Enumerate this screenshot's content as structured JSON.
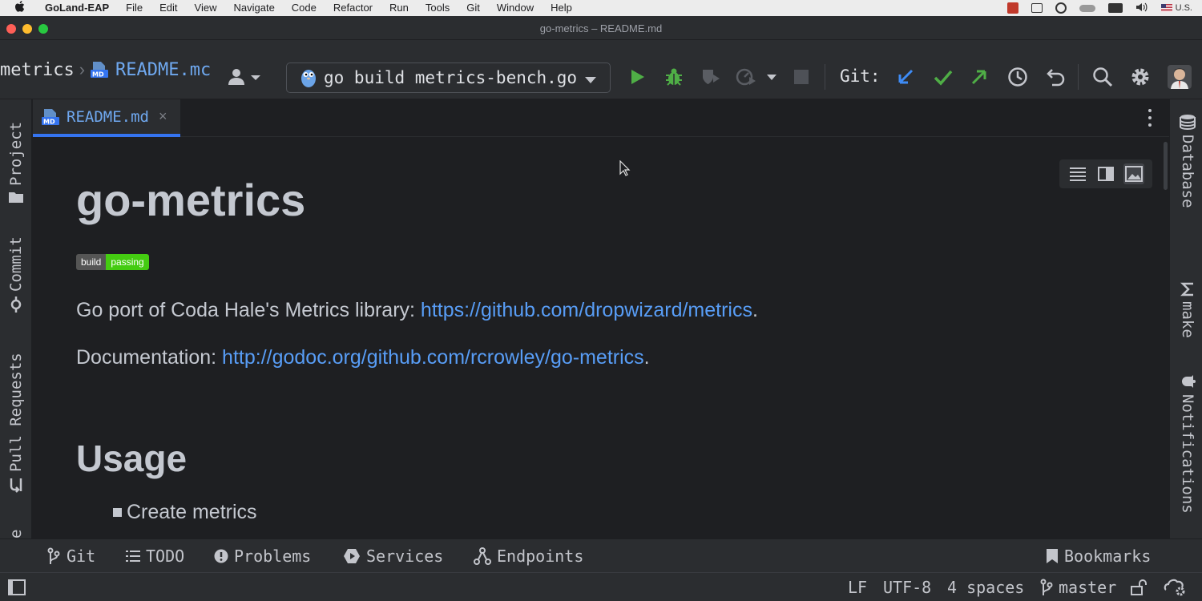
{
  "menubar": {
    "app": "GoLand-EAP",
    "items": [
      "File",
      "Edit",
      "View",
      "Navigate",
      "Code",
      "Refactor",
      "Run",
      "Tools",
      "Git",
      "Window",
      "Help"
    ],
    "input_source": "U.S."
  },
  "window": {
    "title": "go-metrics – README.md"
  },
  "toolbar": {
    "project_crumb": "metrics",
    "file_crumb": "README.mc",
    "run_config": "go build metrics-bench.go",
    "git_label": "Git:"
  },
  "left_stripe": {
    "project": "Project",
    "commit": "Commit",
    "pull_requests": "Pull Requests",
    "cut_label": "e"
  },
  "right_stripe": {
    "database": "Database",
    "make": "make",
    "notifications": "Notifications"
  },
  "tabs": [
    {
      "label": "README.md",
      "active": true
    }
  ],
  "preview": {
    "title": "go-metrics",
    "badge_left": "build",
    "badge_right": "passing",
    "line1_text": "Go port of Coda Hale's Metrics library: ",
    "line1_link": "https://github.com/dropwizard/metrics",
    "line1_end": ".",
    "line2_text": "Documentation: ",
    "line2_link": "http://godoc.org/github.com/rcrowley/go-metrics",
    "line2_end": ".",
    "heading2": "Usage",
    "bullet1": "Create metrics"
  },
  "bottom_tools": {
    "git": "Git",
    "todo": "TODO",
    "problems": "Problems",
    "services": "Services",
    "endpoints": "Endpoints",
    "bookmarks": "Bookmarks"
  },
  "status": {
    "line_sep": "LF",
    "encoding": "UTF-8",
    "indent": "4 spaces",
    "branch": "master"
  },
  "colors": {
    "accent": "#3574f0",
    "link": "#589df6",
    "run_green": "#4fae46",
    "badge_green": "#44cc11"
  }
}
